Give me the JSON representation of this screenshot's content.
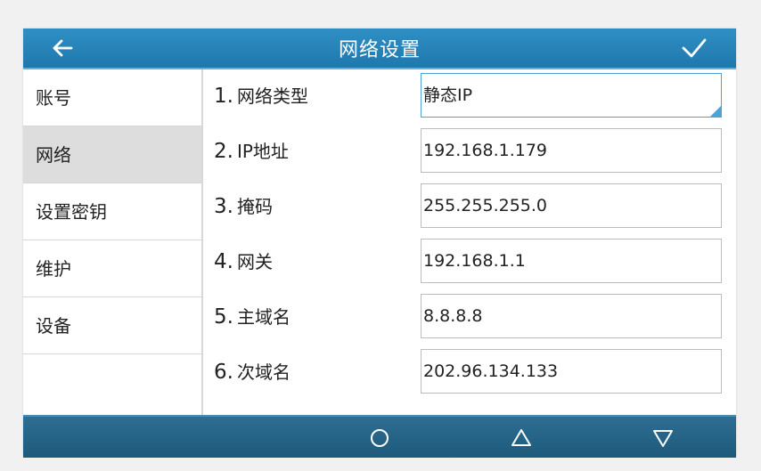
{
  "header": {
    "title": "网络设置",
    "back_icon": "arrow-left-icon",
    "confirm_icon": "checkmark-icon"
  },
  "sidebar": {
    "items": [
      {
        "label": "账号",
        "active": false
      },
      {
        "label": "网络",
        "active": true
      },
      {
        "label": "设置密钥",
        "active": false
      },
      {
        "label": "维护",
        "active": false
      },
      {
        "label": "设备",
        "active": false
      }
    ]
  },
  "settings": [
    {
      "num": "1.",
      "label": "网络类型",
      "value": "静态IP"
    },
    {
      "num": "2.",
      "label": "IP地址",
      "value": "192.168.1.179"
    },
    {
      "num": "3.",
      "label": "掩码",
      "value": "255.255.255.0"
    },
    {
      "num": "4.",
      "label": "网关",
      "value": "192.168.1.1"
    },
    {
      "num": "5.",
      "label": "主域名",
      "value": "8.8.8.8"
    },
    {
      "num": "6.",
      "label": "次域名",
      "value": "202.96.134.133"
    }
  ],
  "softkeys": [
    "circle-icon",
    "triangle-up-icon",
    "triangle-down-icon"
  ],
  "colors": {
    "titlebar": "#2f8fc4",
    "bottombar": "#1d5a7c",
    "active_item": "#dddddd"
  }
}
